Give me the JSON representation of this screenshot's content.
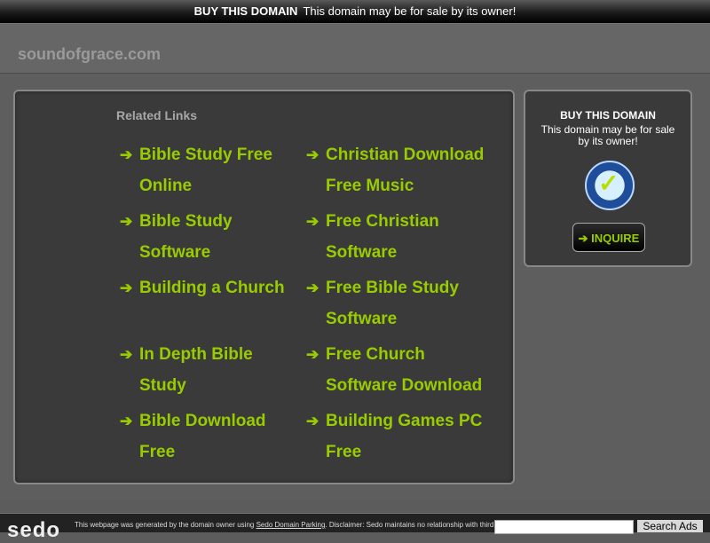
{
  "topbar": {
    "buy_label": "BUY THIS DOMAIN",
    "sale_text": "This domain may be for sale by its owner!"
  },
  "header": {
    "site_name": "soundofgrace.com"
  },
  "related": {
    "title": "Related Links",
    "left_links": [
      [
        "Bible Study Free",
        "Online"
      ],
      [
        "Bible Study",
        "Software"
      ],
      [
        "Building a Church"
      ],
      [
        "In Depth Bible",
        "Study"
      ],
      [
        "Bible Download",
        "Free"
      ]
    ],
    "right_links": [
      [
        "Christian Download",
        "Free Music"
      ],
      [
        "Free Christian",
        "Software"
      ],
      [
        "Free Bible Study",
        "Software"
      ],
      [
        "Free Church",
        "Software Download"
      ],
      [
        "Building Games PC",
        "Free"
      ]
    ]
  },
  "sidebox": {
    "title": "BUY THIS DOMAIN",
    "text": "This domain may be for sale by its owner!",
    "seal_icon": "sedo-buyer-protection-seal-icon",
    "inquire_label": "INQUIRE",
    "inquire_icon": "arrow-right-icon"
  },
  "footer": {
    "logo": "sedo",
    "disclaimer_pre": "This webpage was generated by the domain owner using",
    "disclaimer_link": "Sedo Domain Parking",
    "disclaimer_post": ". Disclaimer: Sedo maintains no relationship with third",
    "search_button": "Search Ads"
  },
  "colors": {
    "link_green": "#99cc00",
    "panel_bg": "#3a3a3a",
    "page_bg": "#5c5c5c"
  }
}
